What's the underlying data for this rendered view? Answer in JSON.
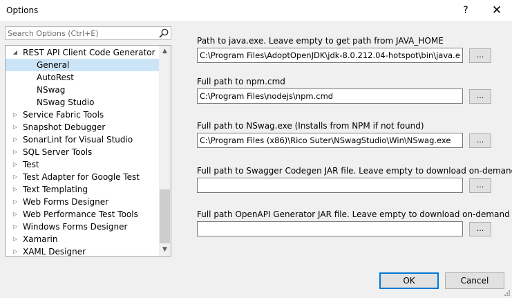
{
  "window": {
    "title": "Options",
    "help_label": "?",
    "close_label": "✕"
  },
  "search": {
    "placeholder": "Search Options (Ctrl+E)",
    "value": ""
  },
  "tree": {
    "items": [
      {
        "label": "REST API Client Code Generator",
        "expanded": true,
        "has_children": true,
        "level": 0
      },
      {
        "label": "General",
        "selected": true,
        "level": 1
      },
      {
        "label": "AutoRest",
        "level": 1
      },
      {
        "label": "NSwag",
        "level": 1
      },
      {
        "label": "NSwag Studio",
        "level": 1
      },
      {
        "label": "Service Fabric Tools",
        "has_children": true,
        "level": 0
      },
      {
        "label": "Snapshot Debugger",
        "has_children": true,
        "level": 0
      },
      {
        "label": "SonarLint for Visual Studio",
        "has_children": true,
        "level": 0
      },
      {
        "label": "SQL Server Tools",
        "has_children": true,
        "level": 0
      },
      {
        "label": "Test",
        "has_children": true,
        "level": 0
      },
      {
        "label": "Test Adapter for Google Test",
        "has_children": true,
        "level": 0
      },
      {
        "label": "Text Templating",
        "has_children": true,
        "level": 0
      },
      {
        "label": "Web Forms Designer",
        "has_children": true,
        "level": 0
      },
      {
        "label": "Web Performance Test Tools",
        "has_children": true,
        "level": 0
      },
      {
        "label": "Windows Forms Designer",
        "has_children": true,
        "level": 0
      },
      {
        "label": "Xamarin",
        "has_children": true,
        "level": 0
      },
      {
        "label": "XAML Designer",
        "has_children": true,
        "level": 0
      }
    ]
  },
  "settings": [
    {
      "label": "Path to java.exe. Leave empty to get path from JAVA_HOME",
      "value": "C:\\Program Files\\AdoptOpenJDK\\jdk-8.0.212.04-hotspot\\bin\\java.exe",
      "browse_label": "..."
    },
    {
      "label": "Full path to npm.cmd",
      "value": "C:\\Program Files\\nodejs\\npm.cmd",
      "browse_label": "..."
    },
    {
      "label": "Full path to NSwag.exe (Installs from NPM if not found)",
      "value": "C:\\Program Files (x86)\\Rico Suter\\NSwagStudio\\Win\\NSwag.exe",
      "browse_label": "..."
    },
    {
      "label": "Full path to Swagger Codegen JAR file. Leave empty to download on-demand",
      "value": "",
      "browse_label": "..."
    },
    {
      "label": "Full path OpenAPI Generator JAR file. Leave empty to download on-demand",
      "value": "",
      "browse_label": "..."
    }
  ],
  "buttons": {
    "ok": "OK",
    "cancel": "Cancel"
  },
  "colors": {
    "selection": "#cce4f7",
    "default_button_border": "#0078d7"
  }
}
